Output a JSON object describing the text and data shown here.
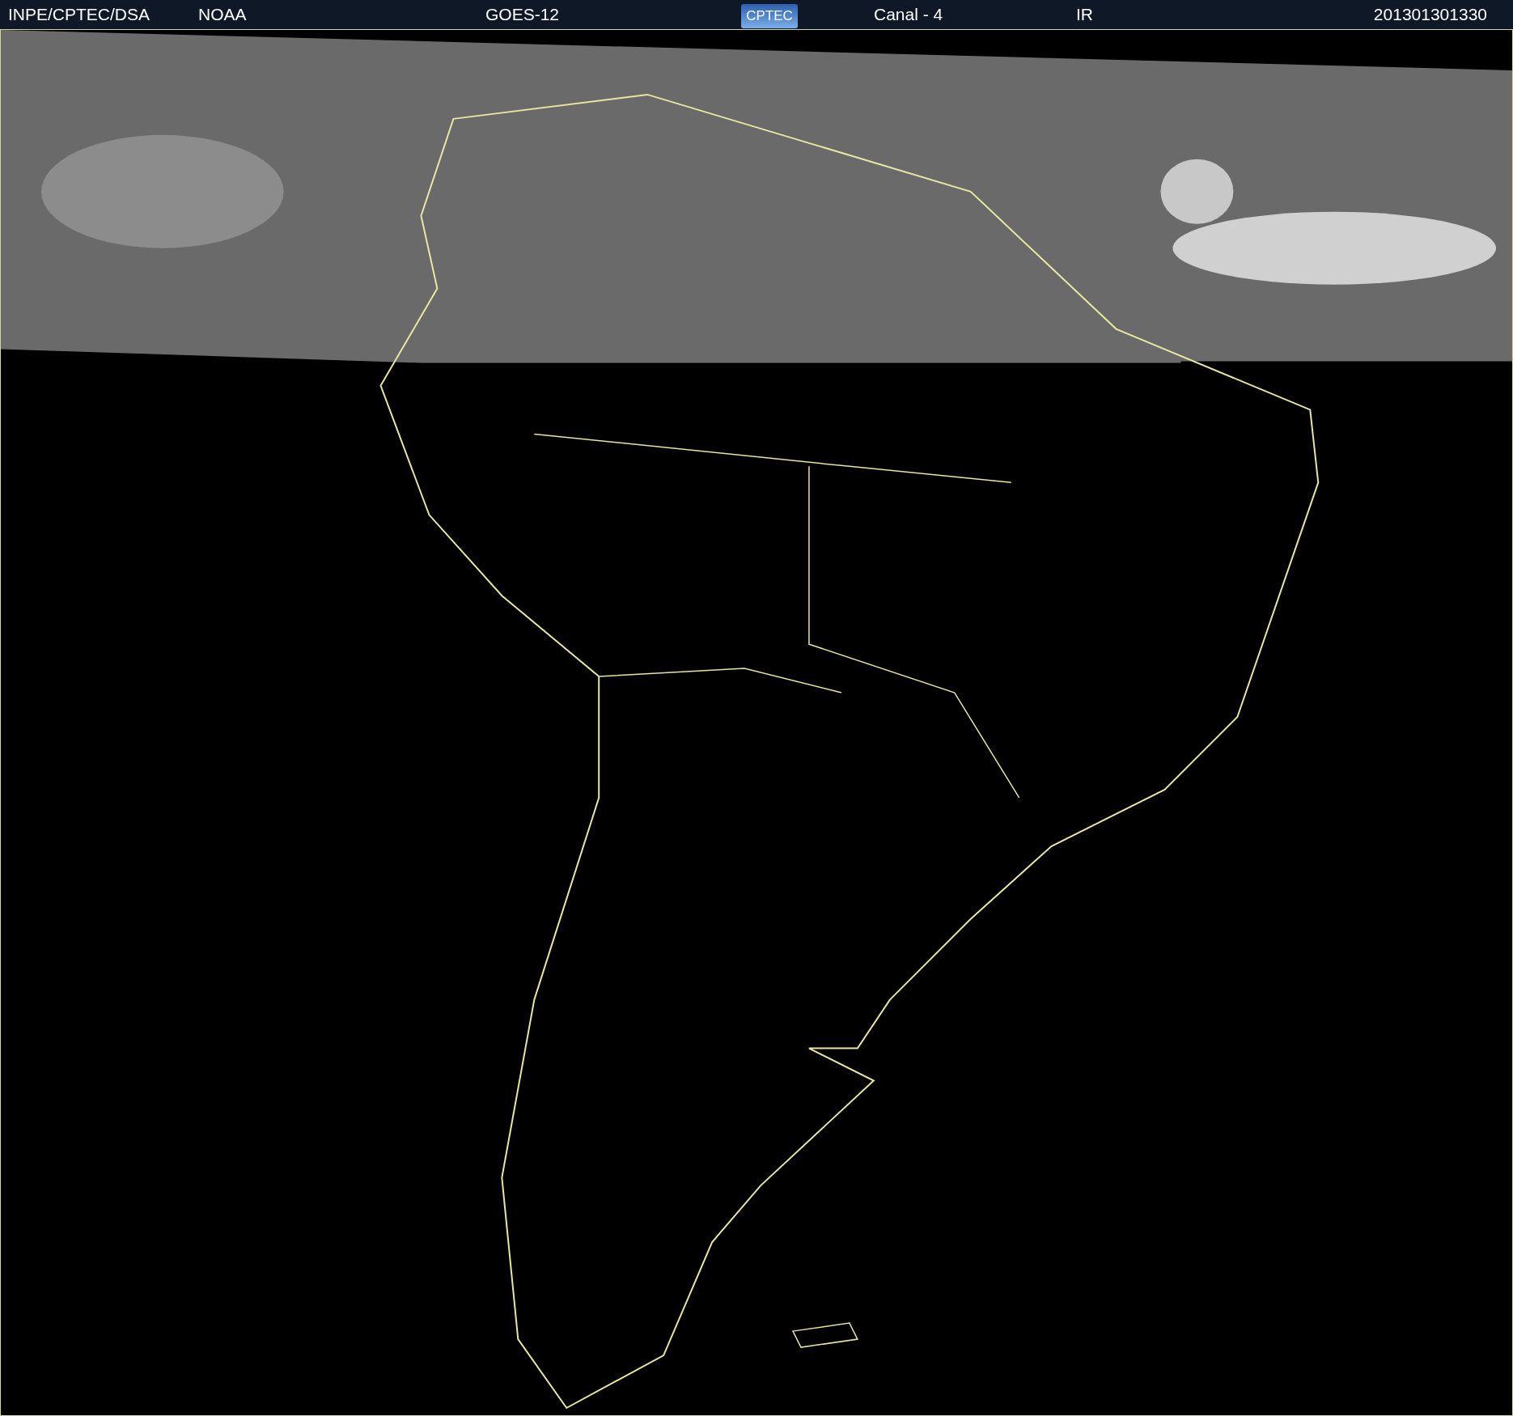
{
  "header": {
    "labels": [
      "INPE/CPTEC/DSA",
      "NOAA",
      "GOES-12"
    ],
    "logo": "CPTEC",
    "channel": "Canal - 4",
    "band": "IR",
    "timestamp": "201301301330"
  }
}
